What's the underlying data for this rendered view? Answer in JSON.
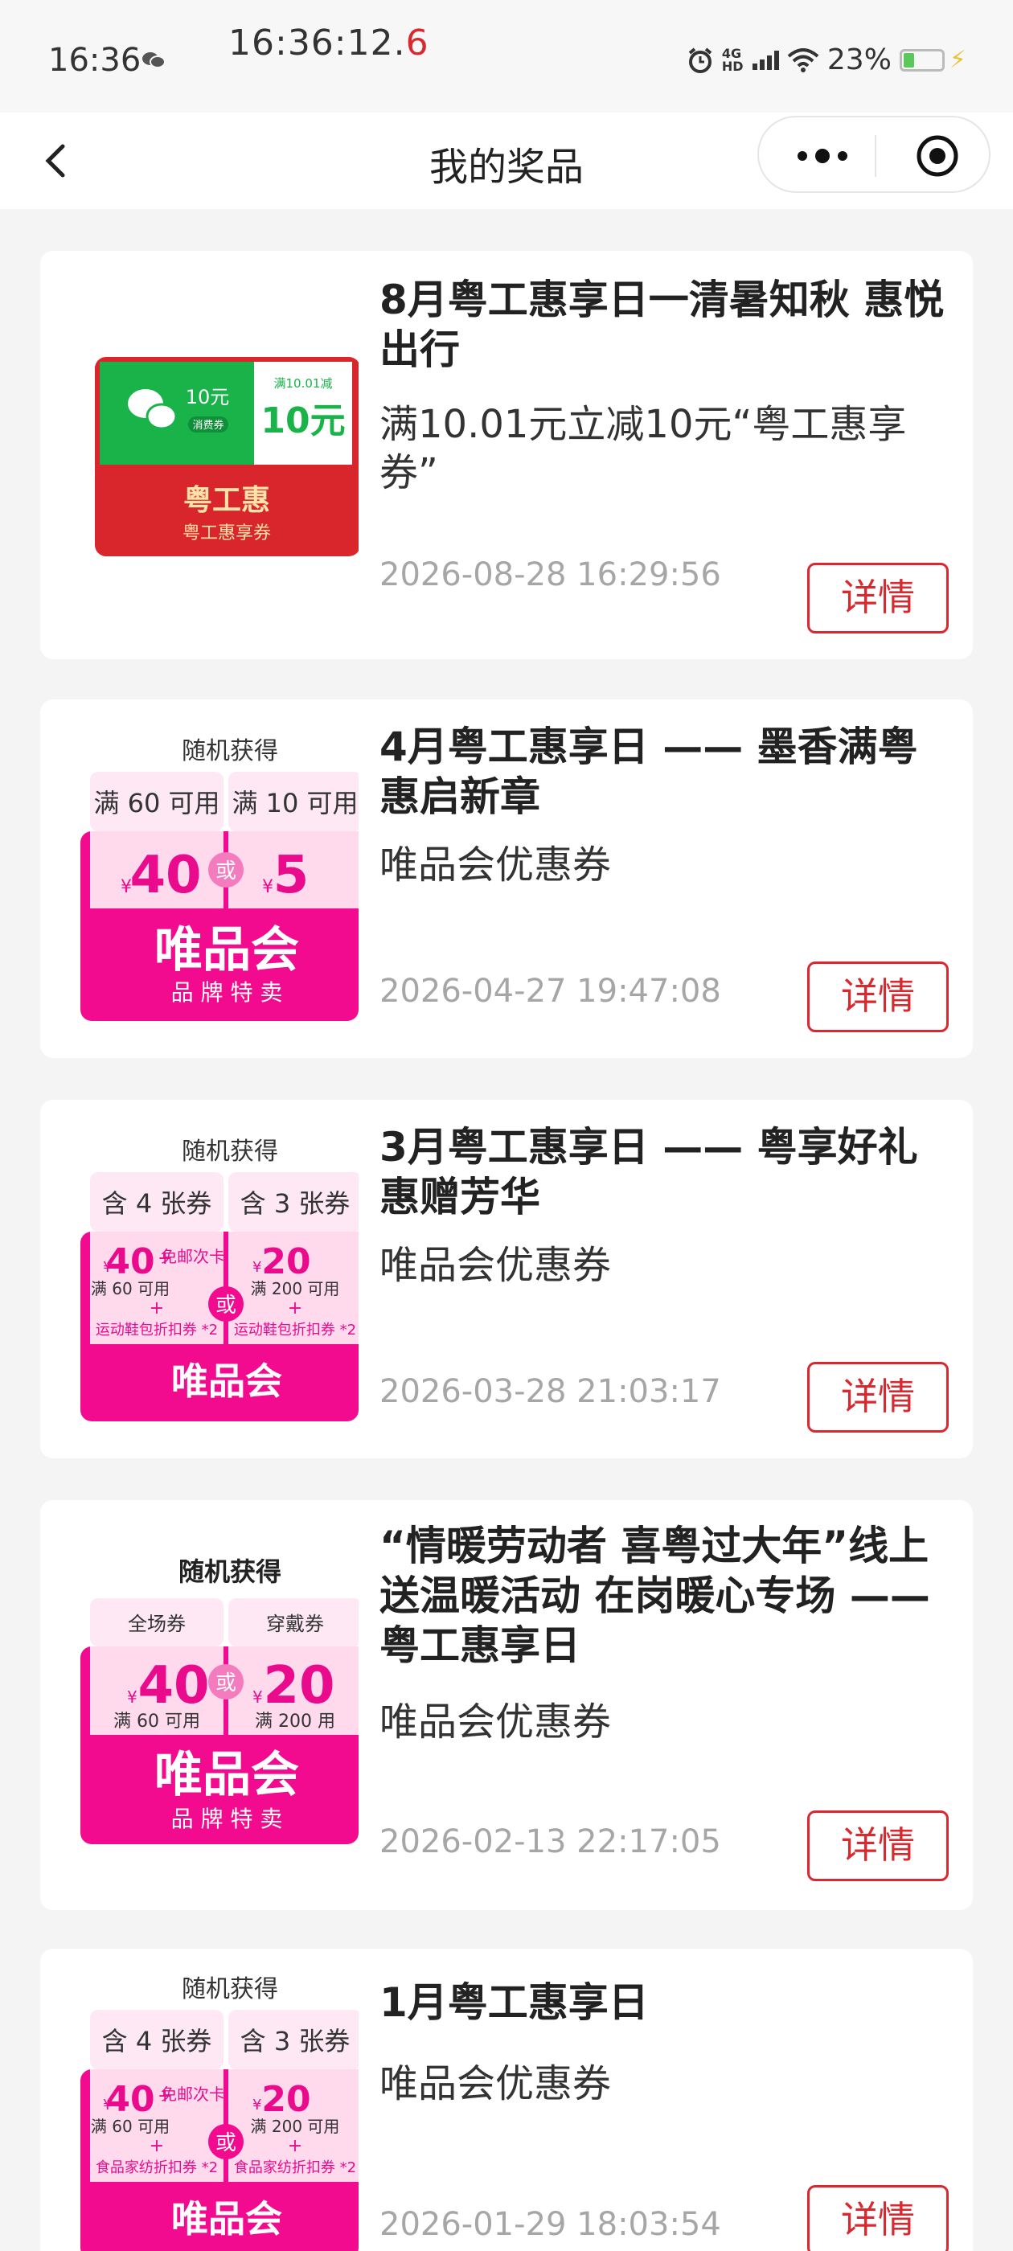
{
  "status_bar": {
    "time": "16:36",
    "clock_main": "16:36:12.",
    "clock_last_digit": "6",
    "network": "4G HD",
    "battery": "23%"
  },
  "nav": {
    "title": "我的奖品",
    "more_icon": "more-dots-icon",
    "close_icon": "target-icon"
  },
  "prizes": [
    {
      "title": "8月粤工惠享日一清暑知秋 惠悦出行",
      "desc": "满10.01元立减10元“粤工惠享券”",
      "date": "2026-08-28 16:29:56",
      "button": "详情",
      "thumb": {
        "value_left": "10元",
        "tag_left": "消费券",
        "cond_right": "满10.01减",
        "value_right": "10元",
        "brand": "粤工惠",
        "sub": "粤工惠享券"
      }
    },
    {
      "title": "4月粤工惠享日 —— 墨香满粤 惠启新章",
      "desc": "唯品会优惠券",
      "date": "2026-04-27 19:47:08",
      "button": "详情",
      "thumb": {
        "header": "随机获得",
        "tab_left": "满 60 可用",
        "tab_right": "满 10 可用",
        "or": "或",
        "cur": "¥",
        "value_left": "40",
        "value_right": "5",
        "brand": "唯品会",
        "sub": "品 牌 特 卖"
      }
    },
    {
      "title": "3月粤工惠享日 —— 粤享好礼 惠赠芳华",
      "desc": "唯品会优惠券",
      "date": "2026-03-28 21:03:17",
      "button": "详情",
      "thumb": {
        "header": "随机获得",
        "tab_left": "含 4 张券",
        "tab_right": "含 3 张券",
        "or": "或",
        "cur": "¥",
        "value_left": "40",
        "value_right": "20",
        "cond_left": "满 60 可用",
        "cond_right": "满 200 可用",
        "extra": "免邮次卡",
        "plus": "+",
        "foot_left": "运动鞋包折扣券 *2",
        "foot_right": "运动鞋包折扣券 *2",
        "brand": "唯品会"
      }
    },
    {
      "title": "“情暖劳动者 喜粤过大年”线上送温暖活动 在岗暖心专场 —— 粤工惠享日",
      "desc": "唯品会优惠券",
      "date": "2026-02-13 22:17:05",
      "button": "详情",
      "thumb": {
        "header": "随机获得",
        "tab_left": "全场券",
        "tab_right": "穿戴券",
        "or": "或",
        "cur": "¥",
        "value_left": "40",
        "value_right": "20",
        "cond_left": "满 60 可用",
        "cond_right": "满 200 用",
        "brand": "唯品会",
        "sub": "品 牌 特 卖"
      }
    },
    {
      "title": "1月粤工惠享日",
      "desc": "唯品会优惠券",
      "date": "2026-01-29 18:03:54",
      "button": "详情",
      "thumb": {
        "header": "随机获得",
        "tab_left": "含 4 张券",
        "tab_right": "含 3 张券",
        "or": "或",
        "cur": "¥",
        "value_left": "40",
        "value_right": "20",
        "cond_left": "满 60 可用",
        "cond_right": "满 200 可用",
        "extra": "免邮次卡",
        "plus": "+",
        "foot_left": "食品家纺折扣券 *2",
        "foot_right": "食品家纺折扣券 *2",
        "brand": "唯品会"
      }
    }
  ]
}
